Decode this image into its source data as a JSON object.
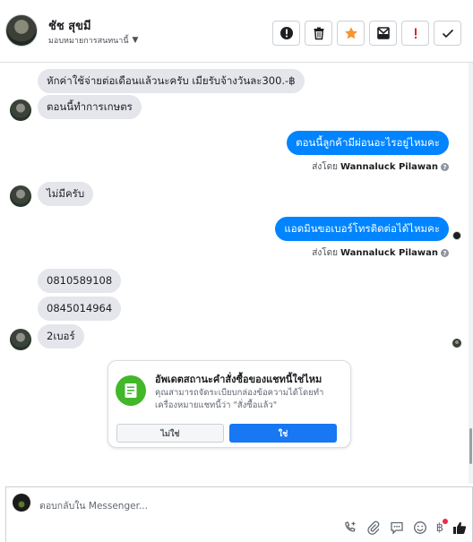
{
  "header": {
    "contact_name": "ชัช สุขมี",
    "assign_label": "มอบหมายการสนทนานี้",
    "tools": [
      "alert-circle",
      "trash",
      "star",
      "mail-mark",
      "exclamation",
      "check"
    ]
  },
  "colors": {
    "outgoing_bubble": "#0084ff",
    "incoming_bubble": "#e4e6eb",
    "star_orange": "#f79433",
    "exclamation_red": "#e02020",
    "status_green": "#42b72a",
    "yes_button": "#1877f2"
  },
  "messages": [
    {
      "dir": "in",
      "text": "หักค่าใช้จ่ายต่อเดือนแล้วนะครับ เมียรับจ้างวันละ300.-฿"
    },
    {
      "dir": "in",
      "text": "ตอนนี้ทำการเกษตร"
    },
    {
      "dir": "out",
      "text": "ตอนนี้ลูกค้ามีผ่อนอะไรอยู่ไหมคะ"
    },
    {
      "dir": "in",
      "text": "ไม่มีครับ"
    },
    {
      "dir": "out",
      "text": "แอดมินขอเบอร์โทรติดต่อได้ไหมคะ"
    },
    {
      "dir": "in",
      "text": "0810589108"
    },
    {
      "dir": "in",
      "text": "0845014964"
    },
    {
      "dir": "in",
      "text": "2เบอร์"
    }
  ],
  "sent_by": {
    "prefix": "ส่งโดย",
    "agent": "Wannaluck Pilawan"
  },
  "status_card": {
    "title": "อัพเดตสถานะคำสั่งซื้อของแชทนี้ใช่ไหม",
    "description": "คุณสามารถจัดระเบียบกล่องข้อความได้โดยทำเครื่องหมายแชทนี้ว่า \"สั่งซื้อแล้ว\"",
    "no_label": "ไม่ใช่",
    "yes_label": "ใช่"
  },
  "composer": {
    "placeholder": "ตอบกลับใน Messenger...",
    "icons": [
      "phone-plus-icon",
      "paperclip-icon",
      "chat-icon",
      "emoji-icon",
      "baht-icon",
      "thumbs-up-icon"
    ],
    "baht_symbol": "฿"
  }
}
